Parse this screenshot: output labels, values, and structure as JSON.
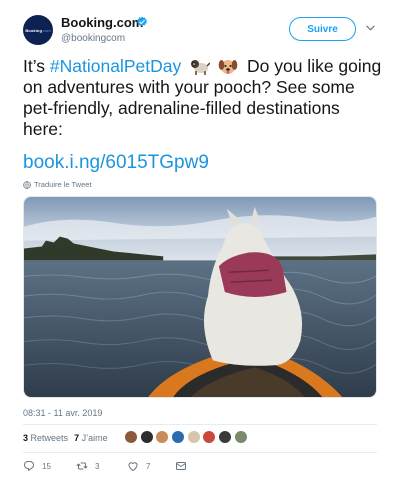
{
  "author": {
    "name": "Booking.com",
    "handle": "@bookingcom",
    "avatar_text": "Booking",
    "avatar_dot": ".com",
    "verified": true,
    "avatar_color": "#0d2252"
  },
  "follow_button": {
    "label": "Suivre"
  },
  "tweet": {
    "text_before": "It’s ",
    "hashtag": "#NationalPetDay",
    "text_after_emojis": "Do you like going on adventures with your pooch? See some pet-friendly, adrenaline-filled destinations here:",
    "emojis": [
      "dog-emoji",
      "dog-face-emoji"
    ],
    "link": "book.i.ng/6015TGpw9",
    "translate_label": "Traduire le Tweet"
  },
  "media": {
    "icon": "dog-in-kayak-photo"
  },
  "timestamp": "08:31 - 11 avr. 2019",
  "stats": {
    "retweets_count": "3",
    "retweets_label": "Retweets",
    "likes_count": "7",
    "likes_label": "J’aime"
  },
  "likers": [
    {
      "color": "#8b5a3c"
    },
    {
      "color": "#2d2d2d"
    },
    {
      "color": "#c98b5a"
    },
    {
      "color": "#2b6cb0"
    },
    {
      "color": "#d6c5a8"
    },
    {
      "color": "#c94a3c"
    },
    {
      "color": "#3a3a3a"
    },
    {
      "color": "#7a8a6a"
    }
  ],
  "actions": {
    "reply_count": "15",
    "retweet_count": "3",
    "like_count": "7"
  },
  "colors": {
    "link_blue": "#1b95e0",
    "twitter_blue": "#1da1f2",
    "secondary_text": "#657786"
  }
}
